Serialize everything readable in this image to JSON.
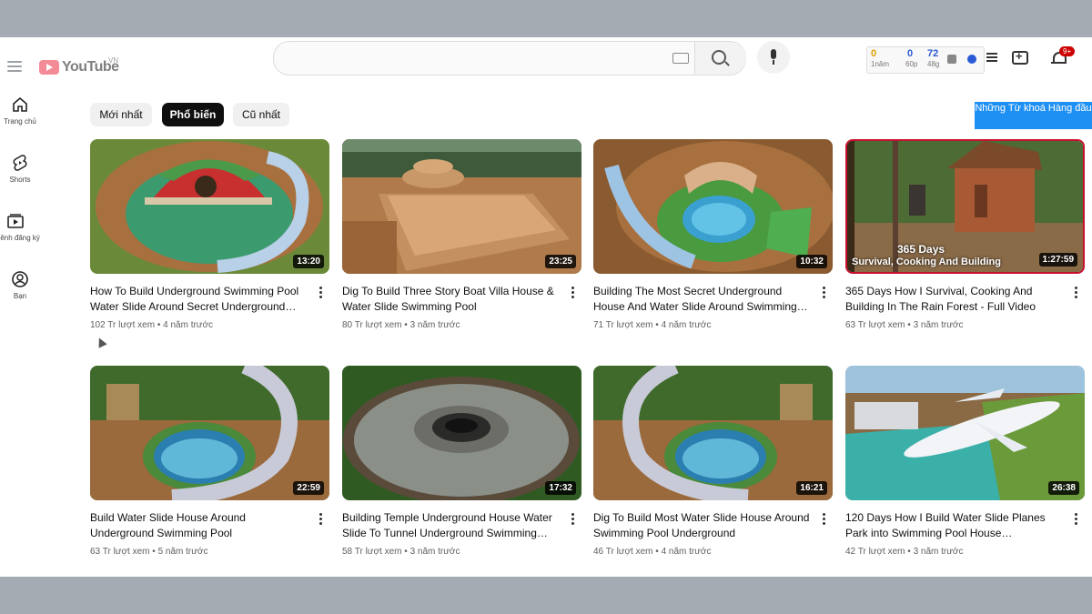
{
  "header": {
    "logo_text": "YouTube",
    "logo_region": "VN",
    "search_placeholder": "",
    "extension": {
      "a_value": "0",
      "a_label": "1năm",
      "b_value": "0",
      "b_label": "60p",
      "c_value": "72",
      "c_label": "48g"
    },
    "notifications_badge": "9+"
  },
  "sidebar": {
    "items": [
      {
        "label": "Trang chủ",
        "icon": "home-icon"
      },
      {
        "label": "Shorts",
        "icon": "shorts-icon"
      },
      {
        "label": "Kênh đăng ký",
        "icon": "subscriptions-icon"
      },
      {
        "label": "Bạn",
        "icon": "you-icon"
      }
    ]
  },
  "chips": [
    {
      "label": "Mới nhất"
    },
    {
      "label": "Phổ biến"
    },
    {
      "label": "Cũ nhất"
    }
  ],
  "keyword_button": "Những Từ khoá Hàng đầu",
  "videos": [
    {
      "title": "How To Build Underground Swimming Pool Water Slide Around Secret Underground House",
      "views": "102 Tr lượt xem",
      "age": "4 năm trước",
      "duration": "13:20"
    },
    {
      "title": "Dig To Build Three Story Boat Villa House & Water Slide Swimming Pool",
      "views": "80 Tr lượt xem",
      "age": "3 năm trước",
      "duration": "23:25"
    },
    {
      "title": "Building The Most Secret Underground House And Water Slide Around Swimming Pool",
      "views": "71 Tr lượt xem",
      "age": "4 năm trước",
      "duration": "10:32"
    },
    {
      "title": "365 Days How I Survival, Cooking And Building In The Rain Forest - Full Video",
      "views": "63 Tr lượt xem",
      "age": "3 năm trước",
      "duration": "1:27:59",
      "caption_line1": "365 Days",
      "caption_line2": "Survival, Cooking And Building"
    },
    {
      "title": "Build Water Slide House Around Underground Swimming Pool",
      "views": "63 Tr lượt xem",
      "age": "5 năm trước",
      "duration": "22:59"
    },
    {
      "title": "Building Temple Underground House Water Slide To Tunnel Underground Swimming Pool",
      "views": "58 Tr lượt xem",
      "age": "3 năm trước",
      "duration": "17:32"
    },
    {
      "title": "Dig To Build Most Water Slide House Around Swimming Pool Underground",
      "views": "46 Tr lượt xem",
      "age": "4 năm trước",
      "duration": "16:21"
    },
    {
      "title": "120 Days How I Build Water Slide Planes Park into Swimming Pool House Underground",
      "views": "42 Tr lượt xem",
      "age": "3 năm trước",
      "duration": "26:38"
    }
  ]
}
